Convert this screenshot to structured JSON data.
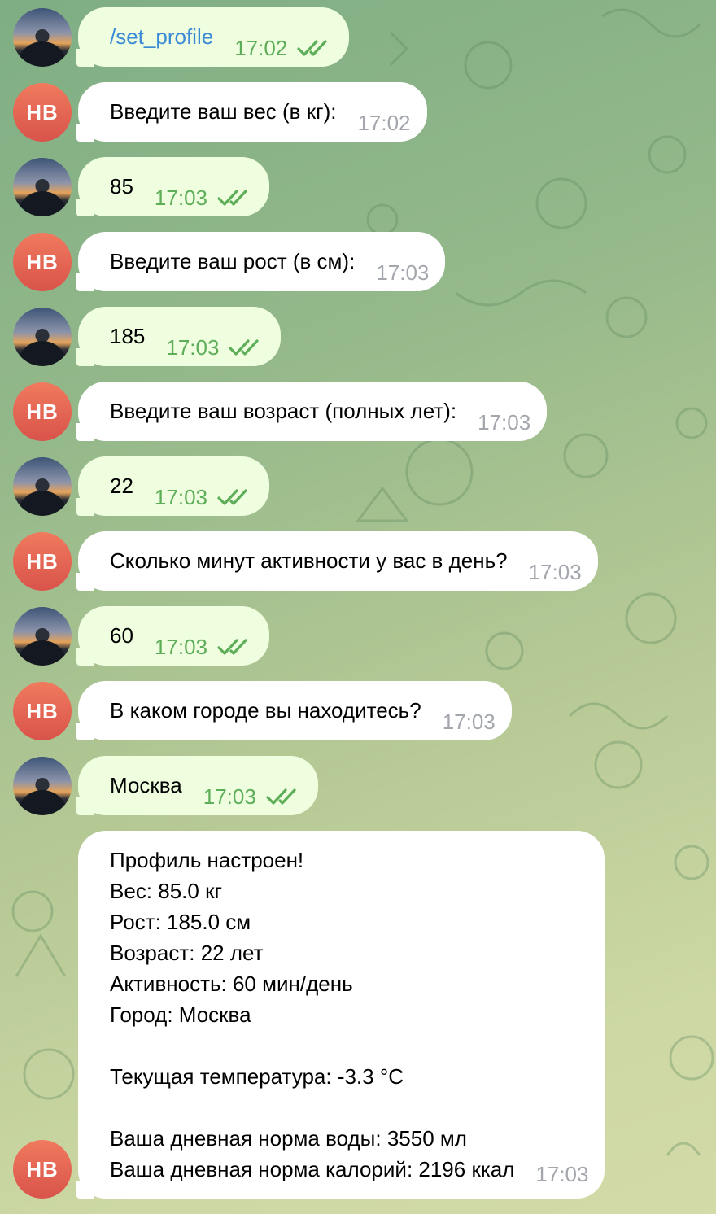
{
  "colors": {
    "outgoing_bubble": "#eefedf",
    "incoming_bubble": "#ffffff",
    "outgoing_time": "#5eae59",
    "incoming_time": "#a3a7ad",
    "command_link": "#3a8ad6",
    "bot_avatar": "#e0604f"
  },
  "bot_avatar_initials": "HB",
  "messages": [
    {
      "dir": "out",
      "text": "/set_profile",
      "time": "17:02",
      "is_command": true
    },
    {
      "dir": "in",
      "text": "Введите ваш вес (в кг):",
      "time": "17:02"
    },
    {
      "dir": "out",
      "text": "85",
      "time": "17:03"
    },
    {
      "dir": "in",
      "text": "Введите ваш рост (в см):",
      "time": "17:03"
    },
    {
      "dir": "out",
      "text": "185",
      "time": "17:03"
    },
    {
      "dir": "in",
      "text": "Введите ваш возраст (полных лет):",
      "time": "17:03"
    },
    {
      "dir": "out",
      "text": "22",
      "time": "17:03"
    },
    {
      "dir": "in",
      "text": "Сколько минут активности у вас в день?",
      "time": "17:03"
    },
    {
      "dir": "out",
      "text": "60",
      "time": "17:03"
    },
    {
      "dir": "in",
      "text": "В каком городе вы находитесь?",
      "time": "17:03"
    },
    {
      "dir": "out",
      "text": "Москва",
      "time": "17:03"
    },
    {
      "dir": "in",
      "text": "Профиль настроен!\nВес: 85.0 кг\nРост: 185.0 см\nВозраст: 22 лет\nАктивность: 60 мин/день\nГород: Москва\n\nТекущая температура: -3.3 °C\n\nВаша дневная норма воды: 3550 мл\nВаша дневная норма калорий: 2196 ккал",
      "time": "17:03"
    }
  ]
}
